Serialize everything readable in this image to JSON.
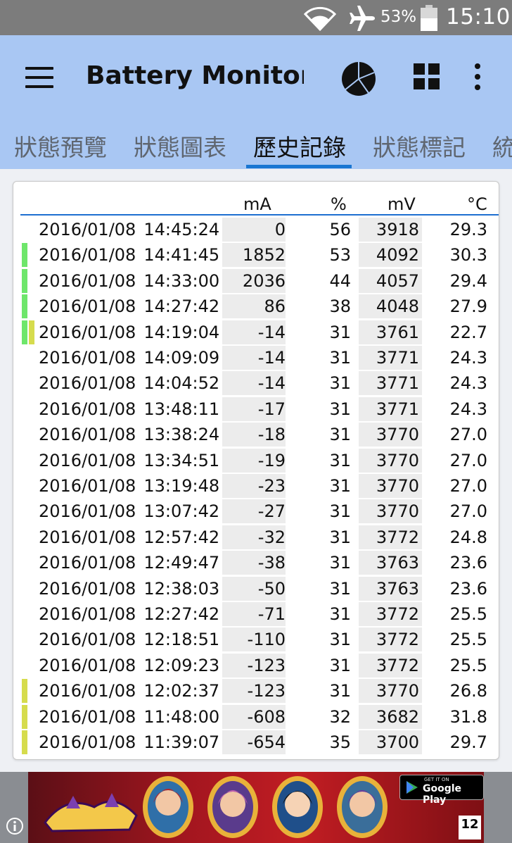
{
  "status_bar": {
    "battery_percent": "53%",
    "time": "15:10",
    "icons": [
      "wifi-icon",
      "airplane-icon",
      "battery-icon"
    ]
  },
  "app_bar": {
    "title": "Battery Monitor...",
    "actions": [
      "menu-icon",
      "pie-chart-icon",
      "grid-icon",
      "more-vert-icon"
    ]
  },
  "tabs": [
    {
      "label": "狀態預覽",
      "active": false
    },
    {
      "label": "狀態圖表",
      "active": false
    },
    {
      "label": "歷史記錄",
      "active": true
    },
    {
      "label": "狀態標記",
      "active": false
    },
    {
      "label": "統",
      "active": false
    }
  ],
  "colors": {
    "app_bar": "#a9c7f3",
    "tab_indicator": "#1976d2",
    "charging_marker": "#6ee66b",
    "plugged_marker": "#d6dc4d",
    "shaded_cell": "#ececec"
  },
  "table": {
    "headers": {
      "ma": "mA",
      "pct": "%",
      "mv": "mV",
      "temp": "°C"
    },
    "rows": [
      {
        "date": "2016/01/08",
        "time": "14:45:24",
        "ma": "0",
        "pct": "56",
        "mv": "3918",
        "temp": "29.3",
        "markers": []
      },
      {
        "date": "2016/01/08",
        "time": "14:41:45",
        "ma": "1852",
        "pct": "53",
        "mv": "4092",
        "temp": "30.3",
        "markers": [
          "green"
        ]
      },
      {
        "date": "2016/01/08",
        "time": "14:33:00",
        "ma": "2036",
        "pct": "44",
        "mv": "4057",
        "temp": "29.4",
        "markers": [
          "green"
        ]
      },
      {
        "date": "2016/01/08",
        "time": "14:27:42",
        "ma": "86",
        "pct": "38",
        "mv": "4048",
        "temp": "27.9",
        "markers": [
          "green"
        ]
      },
      {
        "date": "2016/01/08",
        "time": "14:19:04",
        "ma": "-14",
        "pct": "31",
        "mv": "3761",
        "temp": "22.7",
        "markers": [
          "green",
          "yellow"
        ]
      },
      {
        "date": "2016/01/08",
        "time": "14:09:09",
        "ma": "-14",
        "pct": "31",
        "mv": "3771",
        "temp": "24.3",
        "markers": []
      },
      {
        "date": "2016/01/08",
        "time": "14:04:52",
        "ma": "-14",
        "pct": "31",
        "mv": "3771",
        "temp": "24.3",
        "markers": []
      },
      {
        "date": "2016/01/08",
        "time": "13:48:11",
        "ma": "-17",
        "pct": "31",
        "mv": "3771",
        "temp": "24.3",
        "markers": []
      },
      {
        "date": "2016/01/08",
        "time": "13:38:24",
        "ma": "-18",
        "pct": "31",
        "mv": "3770",
        "temp": "27.0",
        "markers": []
      },
      {
        "date": "2016/01/08",
        "time": "13:34:51",
        "ma": "-19",
        "pct": "31",
        "mv": "3770",
        "temp": "27.0",
        "markers": []
      },
      {
        "date": "2016/01/08",
        "time": "13:19:48",
        "ma": "-23",
        "pct": "31",
        "mv": "3770",
        "temp": "27.0",
        "markers": []
      },
      {
        "date": "2016/01/08",
        "time": "13:07:42",
        "ma": "-27",
        "pct": "31",
        "mv": "3770",
        "temp": "27.0",
        "markers": []
      },
      {
        "date": "2016/01/08",
        "time": "12:57:42",
        "ma": "-32",
        "pct": "31",
        "mv": "3772",
        "temp": "24.8",
        "markers": []
      },
      {
        "date": "2016/01/08",
        "time": "12:49:47",
        "ma": "-38",
        "pct": "31",
        "mv": "3763",
        "temp": "23.6",
        "markers": []
      },
      {
        "date": "2016/01/08",
        "time": "12:38:03",
        "ma": "-50",
        "pct": "31",
        "mv": "3763",
        "temp": "23.6",
        "markers": []
      },
      {
        "date": "2016/01/08",
        "time": "12:27:42",
        "ma": "-71",
        "pct": "31",
        "mv": "3772",
        "temp": "25.5",
        "markers": []
      },
      {
        "date": "2016/01/08",
        "time": "12:18:51",
        "ma": "-110",
        "pct": "31",
        "mv": "3772",
        "temp": "25.5",
        "markers": []
      },
      {
        "date": "2016/01/08",
        "time": "12:09:23",
        "ma": "-123",
        "pct": "31",
        "mv": "3772",
        "temp": "25.5",
        "markers": []
      },
      {
        "date": "2016/01/08",
        "time": "12:02:37",
        "ma": "-123",
        "pct": "31",
        "mv": "3770",
        "temp": "26.8",
        "markers": [
          "yellow"
        ]
      },
      {
        "date": "2016/01/08",
        "time": "11:48:00",
        "ma": "-608",
        "pct": "32",
        "mv": "3682",
        "temp": "31.8",
        "markers": [
          "yellow"
        ]
      },
      {
        "date": "2016/01/08",
        "time": "11:39:07",
        "ma": "-654",
        "pct": "35",
        "mv": "3700",
        "temp": "29.7",
        "markers": [
          "yellow"
        ]
      }
    ]
  },
  "ad": {
    "store_badge_small": "GET IT ON",
    "store_badge": "Google Play",
    "age_rating": "12"
  }
}
